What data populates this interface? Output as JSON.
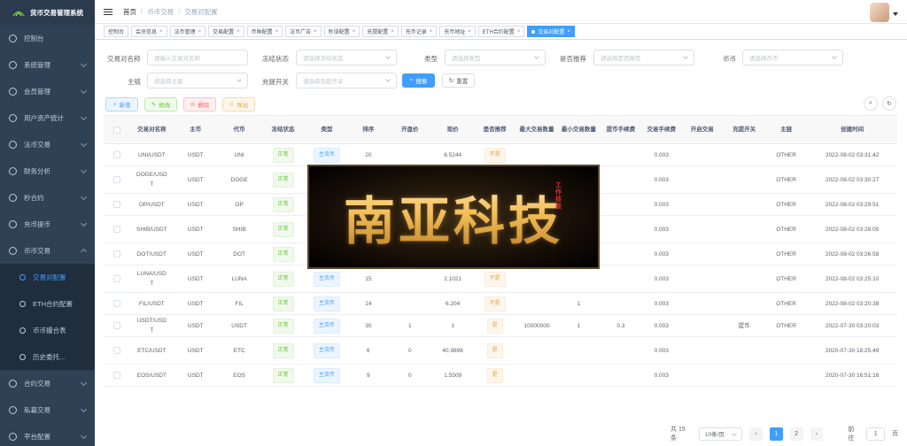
{
  "app": {
    "title": "货币交易管理系统"
  },
  "sidebar": {
    "items": [
      {
        "label": "控制台"
      },
      {
        "label": "系统管理"
      },
      {
        "label": "会员管理"
      },
      {
        "label": "用户资产统计"
      },
      {
        "label": "法币交易"
      },
      {
        "label": "财务分析"
      },
      {
        "label": "秒合约"
      },
      {
        "label": "充币提币"
      },
      {
        "label": "币币交易"
      }
    ],
    "sub_items": [
      {
        "label": "交易对配置"
      },
      {
        "label": "ETH合约配置"
      },
      {
        "label": "币币撮合表"
      },
      {
        "label": "历史委托..."
      }
    ],
    "bottom_items": [
      {
        "label": "合约交易"
      },
      {
        "label": "私募交易"
      },
      {
        "label": "平台配置"
      }
    ]
  },
  "header": {
    "breadcrumb": [
      "首页",
      "币币交易",
      "交易对配置"
    ]
  },
  "tags": [
    {
      "label": "控制台"
    },
    {
      "label": "会员信息"
    },
    {
      "label": "法币管理"
    },
    {
      "label": "交易配置"
    },
    {
      "label": "币种配置"
    },
    {
      "label": "法币广告"
    },
    {
      "label": "秒涨配置"
    },
    {
      "label": "充提配置"
    },
    {
      "label": "充币记录"
    },
    {
      "label": "充币地址"
    },
    {
      "label": "ETH合约配置"
    },
    {
      "label": "交易对配置"
    }
  ],
  "filters": {
    "pair_name": {
      "label": "交易对名称",
      "placeholder": "请输入交易对名称"
    },
    "status": {
      "label": "冻结状态",
      "placeholder": "请选择冻结状态"
    },
    "type": {
      "label": "类型",
      "placeholder": "请选择类型"
    },
    "recommend": {
      "label": "是否推荐",
      "placeholder": "请选择是否推荐"
    },
    "coin": {
      "label": "币币",
      "placeholder": "请选择币币"
    },
    "main_chain": {
      "label": "主链",
      "placeholder": "请选择主链"
    },
    "deposit_switch": {
      "label": "充提开关",
      "placeholder": "请选择充提开关"
    },
    "search_label": "搜索",
    "reset_label": "重置"
  },
  "toolbar": {
    "add_label": "新增",
    "edit_label": "修改",
    "delete_label": "删除",
    "export_label": "导出"
  },
  "table": {
    "columns": [
      "交易对名称",
      "主币",
      "代币",
      "冻结状态",
      "类型",
      "排序",
      "开盘价",
      "现价",
      "是否推荐",
      "最大交易数量",
      "最小交易数量",
      "提币手续费",
      "交易手续费",
      "开启交易",
      "充提开关",
      "主链",
      "创建时间"
    ],
    "rows": [
      {
        "name": "UNI/USDT",
        "main": "USDT",
        "token": "UNI",
        "status": "正常",
        "type": "主流币",
        "sort": "20",
        "open": "",
        "price": "6.5244",
        "recommend": "不是",
        "max": "",
        "min": "",
        "wfee": "",
        "tfee": "0.003",
        "trade": "",
        "deposit": "",
        "chain": "OTHER",
        "created": "2022-08-02 03:31:42"
      },
      {
        "name": "DOGE/USDT",
        "main": "USDT",
        "token": "DOGE",
        "status": "正常",
        "type": "",
        "sort": "",
        "open": "",
        "price": "",
        "recommend": "",
        "max": "",
        "min": "",
        "wfee": "",
        "tfee": "0.003",
        "trade": "",
        "deposit": "",
        "chain": "OTHER",
        "created": "2022-08-02 03:30:27"
      },
      {
        "name": "OP/USDT",
        "main": "USDT",
        "token": "OP",
        "status": "正常",
        "type": "",
        "sort": "",
        "open": "",
        "price": "",
        "recommend": "",
        "max": "",
        "min": "",
        "wfee": "",
        "tfee": "0.003",
        "trade": "",
        "deposit": "",
        "chain": "OTHER",
        "created": "2022-08-02 03:29:51"
      },
      {
        "name": "SHIB/USDT",
        "main": "USDT",
        "token": "SHIB",
        "status": "正常",
        "type": "",
        "sort": "",
        "open": "",
        "price": "",
        "recommend": "",
        "max": "",
        "min": "",
        "wfee": "",
        "tfee": "0.003",
        "trade": "",
        "deposit": "",
        "chain": "OTHER",
        "created": "2022-08-02 03:28:05"
      },
      {
        "name": "DOT/USDT",
        "main": "USDT",
        "token": "DOT",
        "status": "正常",
        "type": "主流币",
        "sort": "",
        "open": "",
        "price": "",
        "recommend": "不是",
        "max": "",
        "min": "",
        "wfee": "",
        "tfee": "0.003",
        "trade": "",
        "deposit": "",
        "chain": "OTHER",
        "created": "2022-08-02 03:26:58"
      },
      {
        "name": "LUNA/USDT",
        "main": "USDT",
        "token": "LUNA",
        "status": "正常",
        "type": "主流币",
        "sort": "15",
        "open": "",
        "price": "2.1021",
        "recommend": "不是",
        "max": "",
        "min": "",
        "wfee": "",
        "tfee": "0.003",
        "trade": "",
        "deposit": "",
        "chain": "OTHER",
        "created": "2022-08-02 03:25:10"
      },
      {
        "name": "FIL/USDT",
        "main": "USDT",
        "token": "FIL",
        "status": "正常",
        "type": "主流币",
        "sort": "14",
        "open": "",
        "price": "6.204",
        "recommend": "不是",
        "max": "",
        "min": "1",
        "wfee": "",
        "tfee": "0.003",
        "trade": "",
        "deposit": "",
        "chain": "OTHER",
        "created": "2022-08-02 03:20:38"
      },
      {
        "name": "USDT/USDT",
        "main": "USDT",
        "token": "USDT",
        "status": "正常",
        "type": "主流币",
        "sort": "30",
        "open": "1",
        "price": "1",
        "recommend": "是",
        "max": "10000000",
        "min": "1",
        "wfee": "0.3",
        "tfee": "0.003",
        "trade": "",
        "deposit": "提币",
        "chain": "OTHER",
        "created": "2022-07-30 03:20:03"
      },
      {
        "name": "ETC/USDT",
        "main": "USDT",
        "token": "ETC",
        "status": "正常",
        "type": "主流币",
        "sort": "6",
        "open": "0",
        "price": "40.9896",
        "recommend": "是",
        "max": "",
        "min": "",
        "wfee": "",
        "tfee": "0.003",
        "trade": "",
        "deposit": "",
        "chain": "",
        "created": "2020-07-30 18:25:49"
      },
      {
        "name": "EOS/USDT",
        "main": "USDT",
        "token": "EOS",
        "status": "正常",
        "type": "主流币",
        "sort": "9",
        "open": "0",
        "price": "1.5509",
        "recommend": "是",
        "max": "",
        "min": "",
        "wfee": "",
        "tfee": "0.003",
        "trade": "",
        "deposit": "",
        "chain": "",
        "created": "2020-07-30 16:51:16"
      }
    ]
  },
  "pagination": {
    "total_text": "共 15 条",
    "page_size": "10条/页",
    "pages": [
      "1",
      "2"
    ],
    "goto_label": "前往",
    "goto_value": "1",
    "goto_suffix": "页"
  },
  "watermark": {
    "text": "南亚科技",
    "small": "工作技能"
  }
}
